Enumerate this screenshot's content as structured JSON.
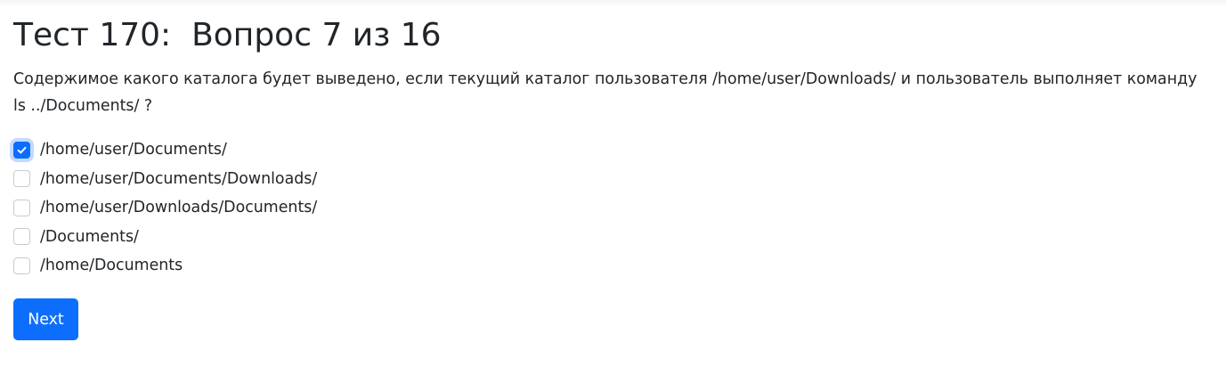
{
  "quiz": {
    "title": "Тест 170:  Вопрос 7 из 16",
    "question": "Содержимое какого каталога будет выведено, если текущий каталог пользователя /home/user/Downloads/ и пользователь выполняет команду ls ../Documents/ ?",
    "options": [
      {
        "label": "/home/user/Documents/",
        "checked": true
      },
      {
        "label": "/home/user/Documents/Downloads/",
        "checked": false
      },
      {
        "label": "/home/user/Downloads/Documents/",
        "checked": false
      },
      {
        "label": "/Documents/",
        "checked": false
      },
      {
        "label": "/home/Documents",
        "checked": false
      }
    ],
    "next_label": "Next"
  },
  "colors": {
    "accent": "#0d6efd",
    "text": "#212529"
  }
}
